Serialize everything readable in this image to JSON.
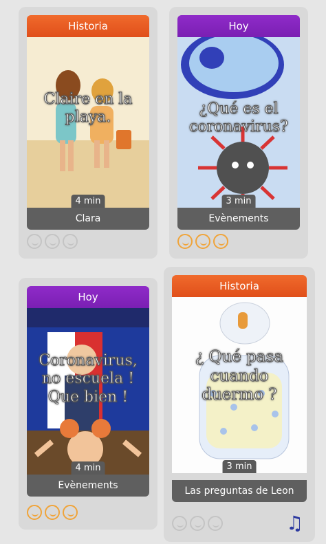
{
  "cards": [
    {
      "header": "Historia",
      "title_line1": "Claire en la",
      "title_line2": "playa.",
      "duration": "4 min",
      "footer": "Clara",
      "rating": "grey"
    },
    {
      "header": "Hoy",
      "title_line1": "¿Qué es el",
      "title_line2": "coronavirus?",
      "duration": "3 min",
      "footer": "Evènements",
      "rating": "orange"
    },
    {
      "header": "Hoy",
      "title_line1": "Coronavirus,",
      "title_line2": "no escuela !",
      "title_line3": "Que bien !",
      "duration": "4 min",
      "footer": "Evènements",
      "rating": "orange"
    },
    {
      "header": "Historia",
      "title_line1": "¿ Qué pasa",
      "title_line2": "cuando",
      "title_line3": "duermo ?",
      "duration": "3 min",
      "footer": "Las preguntas de Leon",
      "rating": "grey"
    }
  ],
  "colors": {
    "historia": "#e8571e",
    "hoy": "#851fbd",
    "rating_orange": "#f0a43a",
    "rating_grey": "#c4c4c4",
    "music_icon": "#2d3aa0"
  },
  "icons": {
    "rating": "smiley-icon",
    "audio": "music-note-icon"
  }
}
